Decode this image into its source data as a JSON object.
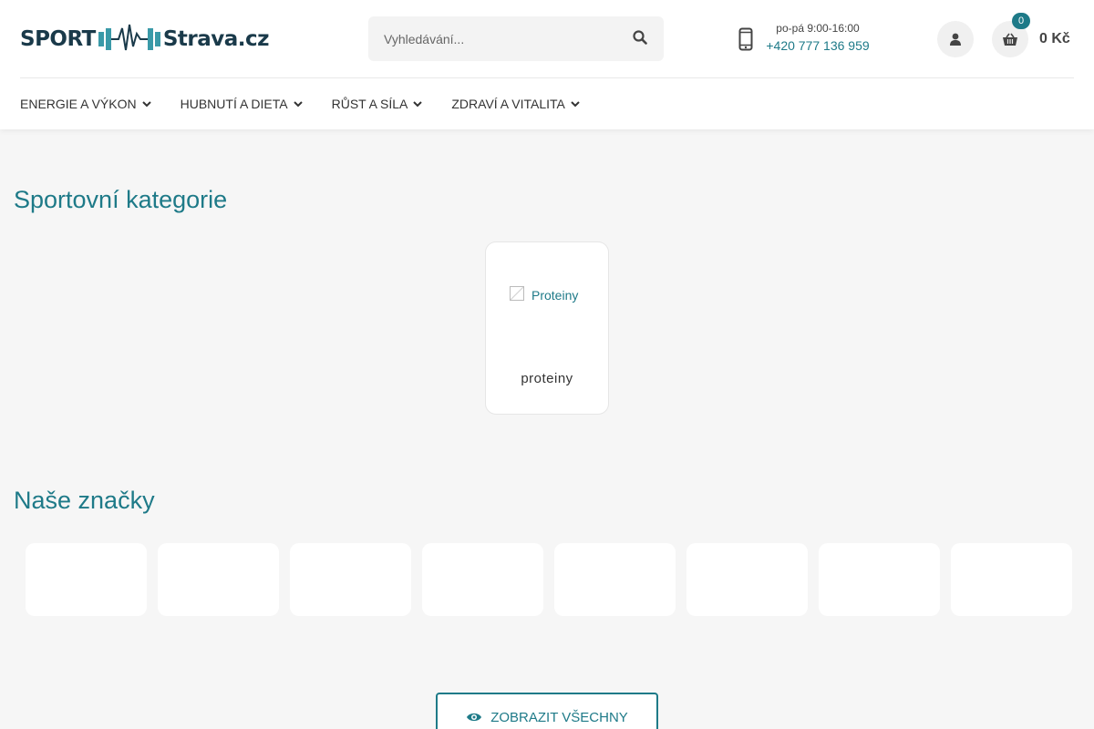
{
  "header": {
    "logo": {
      "left": "SPORT",
      "right": "Strava.cz"
    },
    "search": {
      "placeholder": "Vyhledávání..."
    },
    "contact": {
      "hours": "po-pá 9:00-16:00",
      "phone": "+420 777 136 959"
    },
    "cart": {
      "count": "0",
      "total": "0 Kč"
    }
  },
  "nav": {
    "items": [
      {
        "label": "ENERGIE A VÝKON"
      },
      {
        "label": "HUBNUTÍ A DIETA"
      },
      {
        "label": "RŮST A SÍLA"
      },
      {
        "label": "ZDRAVÍ A VITALITA"
      }
    ]
  },
  "categories": {
    "title": "Sportovní kategorie",
    "items": [
      {
        "image_alt": "Proteiny",
        "label": "proteiny"
      }
    ]
  },
  "brands": {
    "title": "Naše značky",
    "show_all_label": "ZOBRAZIT VŠECHNY"
  },
  "colors": {
    "accent": "#1e7a88",
    "background": "#f6f6f6",
    "logo_dark": "#1a3a4a"
  },
  "icons": [
    "search-icon",
    "phone-icon",
    "user-icon",
    "basket-icon",
    "chevron-down-icon",
    "eye-icon"
  ]
}
